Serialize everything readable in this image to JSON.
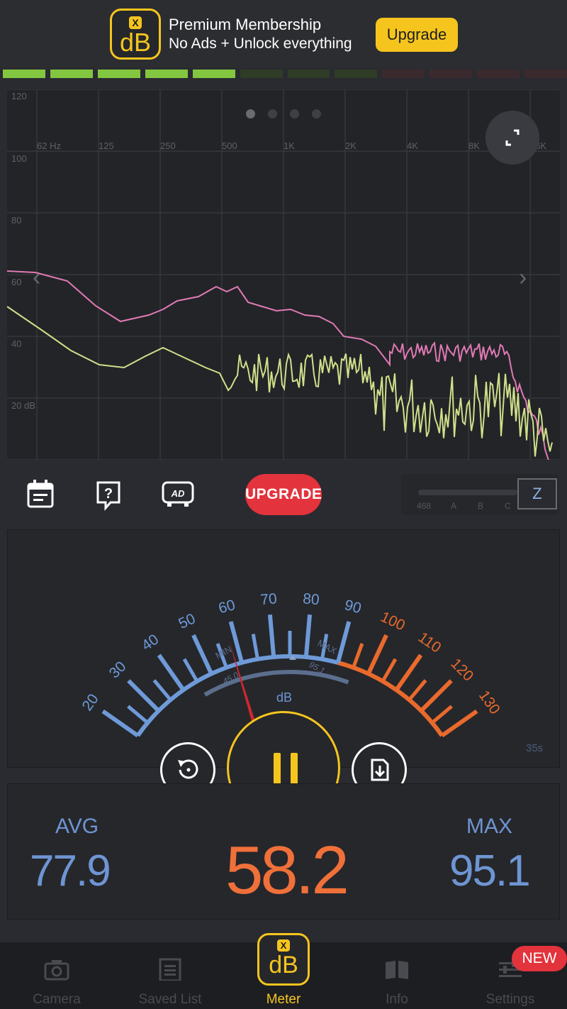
{
  "banner": {
    "logo_badge": "X",
    "logo_text": "dB",
    "title": "Premium Membership",
    "subtitle": "No Ads + Unlock everything",
    "upgrade_label": "Upgrade"
  },
  "level_meter": {
    "active_segments": 5,
    "total_segments": 12,
    "colors": {
      "active": "#83c63f",
      "inactive_green": "#2f3c26",
      "inactive_red": "#3b2a2d"
    }
  },
  "spectrum": {
    "y_ticks": [
      "120",
      "100",
      "80",
      "60",
      "40",
      "20 dB"
    ],
    "x_ticks": [
      "62 Hz",
      "125",
      "250",
      "500",
      "1K",
      "2K",
      "4K",
      "8K",
      "16K"
    ],
    "page_dots": 4,
    "active_page": 0,
    "colors": {
      "peak": "#e07ab4",
      "current": "#cfe08a",
      "grid": "#35363b"
    }
  },
  "toolbar": {
    "history_icon": "calendar-icon",
    "help_icon": "help-icon",
    "ad_icon": "ad-icon",
    "upgrade_label": "UPGRADE",
    "weighting": {
      "labels": [
        "468",
        "A",
        "B",
        "C"
      ],
      "selected": "Z"
    }
  },
  "meter": {
    "scale_blue": [
      "20",
      "30",
      "40",
      "50",
      "60",
      "70",
      "80",
      "90"
    ],
    "scale_orange": [
      "100",
      "110",
      "120",
      "130"
    ],
    "min_label": "MIN",
    "max_label": "MAX",
    "min_value": "45.0",
    "max_value": "95.1",
    "unit": "dB",
    "elapsed": "35s",
    "needle_value": 58.2,
    "colors": {
      "blue": "#6e9ad8",
      "orange": "#e96a2c",
      "needle": "#d1262e"
    }
  },
  "controls": {
    "reset_icon": "reset-icon",
    "pause_icon": "pause-icon",
    "save_icon": "save-icon"
  },
  "stats": {
    "avg_label": "AVG",
    "avg_value": "77.9",
    "current_value": "58.2",
    "max_label": "MAX",
    "max_value": "95.1"
  },
  "tabs": [
    {
      "label": "Camera",
      "icon": "camera-icon"
    },
    {
      "label": "Saved List",
      "icon": "list-icon"
    },
    {
      "label": "Meter",
      "icon": "db-logo-icon"
    },
    {
      "label": "Info",
      "icon": "book-icon"
    },
    {
      "label": "Settings",
      "icon": "settings-icon"
    }
  ],
  "new_badge": "NEW",
  "tab_logo": {
    "badge": "X",
    "text": "dB"
  }
}
